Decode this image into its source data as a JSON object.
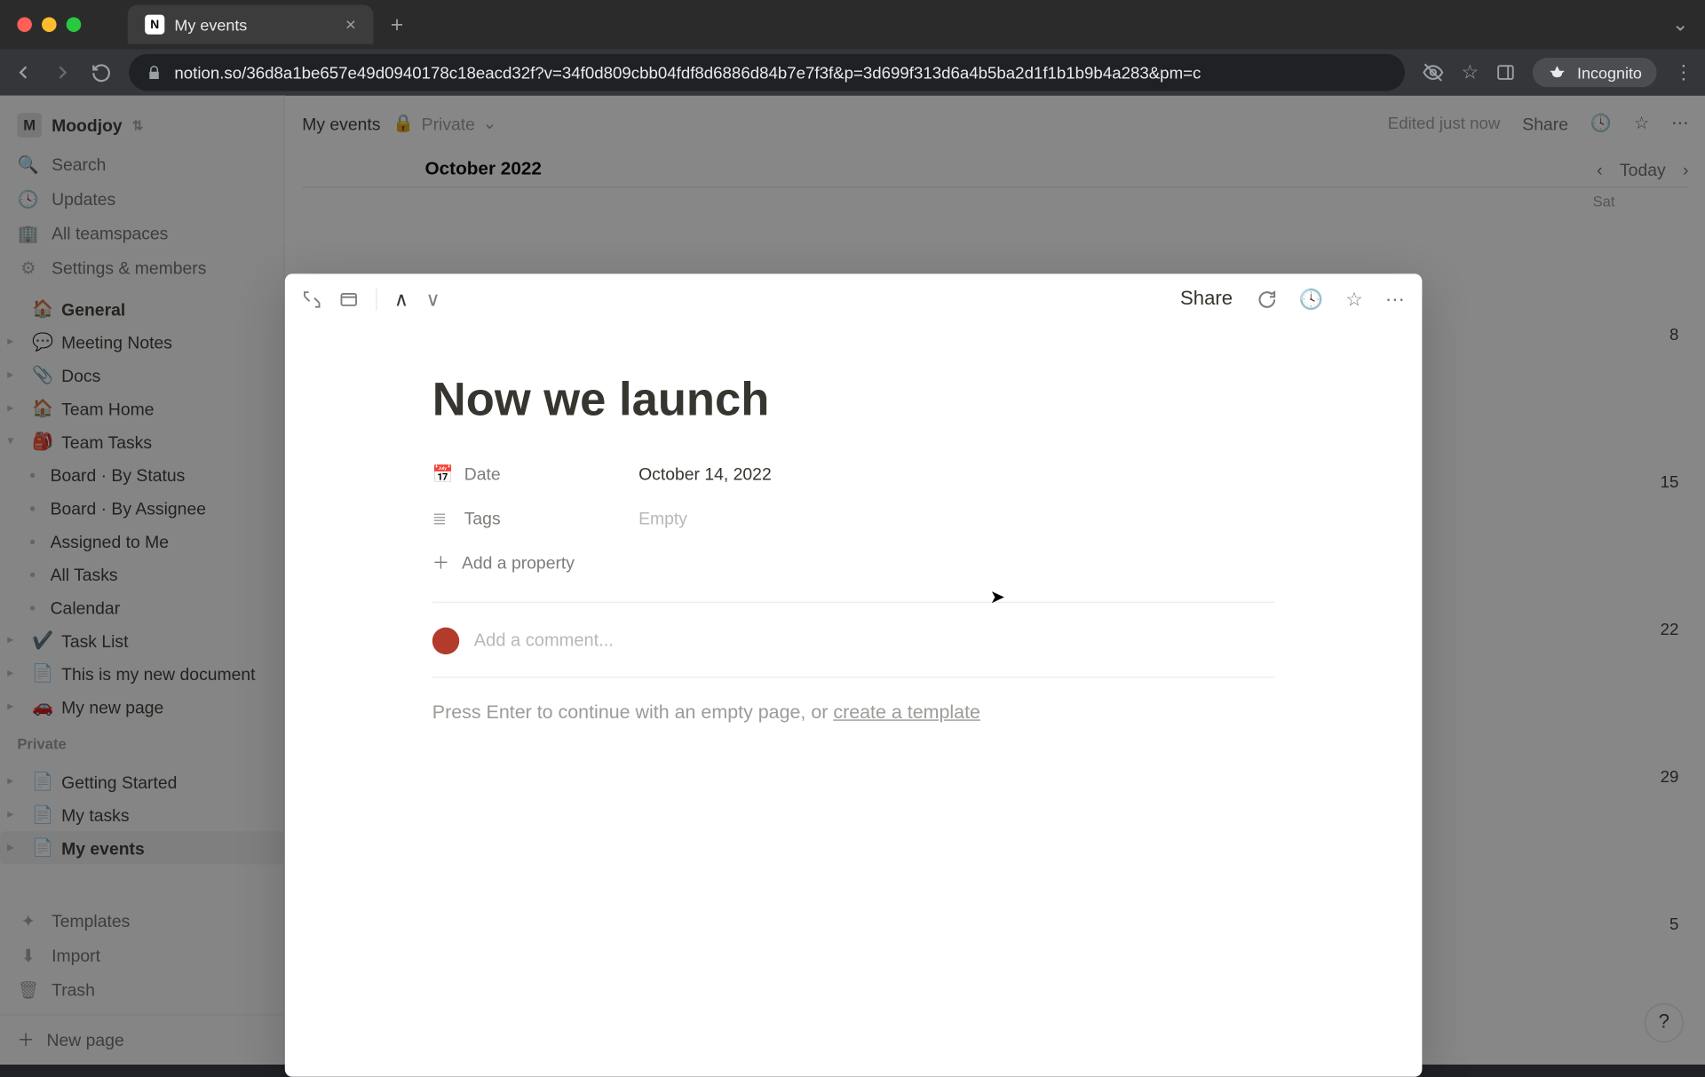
{
  "browser": {
    "tab_title": "My events",
    "url": "notion.so/36d8a1be657e49d0940178c18eacd32f?v=34f0d809cbb04fdf8d6886d84b7e7f3f&p=3d699f313d6a4b5ba2d1f1b1b9b4a283&pm=c",
    "incognito_label": "Incognito"
  },
  "workspace": {
    "initial": "M",
    "name": "Moodjoy"
  },
  "nav": {
    "search": "Search",
    "updates": "Updates",
    "teamspaces": "All teamspaces",
    "settings": "Settings & members"
  },
  "general_label": "General",
  "tree": [
    {
      "emoji": "💬",
      "label": "Meeting Notes"
    },
    {
      "emoji": "📎",
      "label": "Docs"
    },
    {
      "emoji": "🏠",
      "label": "Team Home"
    },
    {
      "emoji": "🎒",
      "label": "Team Tasks",
      "expanded": true,
      "children": [
        {
          "label": "Board · By Status"
        },
        {
          "label": "Board · By Assignee"
        },
        {
          "label": "Assigned to Me"
        },
        {
          "label": "All Tasks"
        },
        {
          "label": "Calendar"
        }
      ]
    },
    {
      "emoji": "✔️",
      "label": "Task List"
    },
    {
      "emoji": "📄",
      "label": "This is my new document"
    },
    {
      "emoji": "🚗",
      "label": "My new page"
    }
  ],
  "private_label": "Private",
  "private_tree": [
    {
      "emoji": "📄",
      "label": "Getting Started"
    },
    {
      "emoji": "📄",
      "label": "My tasks"
    },
    {
      "emoji": "📄",
      "label": "My events",
      "active": true
    }
  ],
  "bottom": {
    "templates": "Templates",
    "import": "Import",
    "trash": "Trash",
    "new_page": "New page"
  },
  "topbar": {
    "breadcrumb": "My events",
    "privacy": "Private",
    "edited": "Edited just now",
    "share": "Share"
  },
  "calendar": {
    "title": "October 2022",
    "today": "Today",
    "sat": "Sat",
    "dates": [
      "8",
      "15",
      "22",
      "29",
      "5"
    ]
  },
  "modal": {
    "share": "Share",
    "title": "Now we launch",
    "props": {
      "date_label": "Date",
      "date_value": "October 14, 2022",
      "tags_label": "Tags",
      "tags_value": "Empty"
    },
    "add_property": "Add a property",
    "comment_placeholder": "Add a comment...",
    "hint_prefix": "Press Enter to continue with an empty page, or ",
    "hint_link": "create a template"
  }
}
